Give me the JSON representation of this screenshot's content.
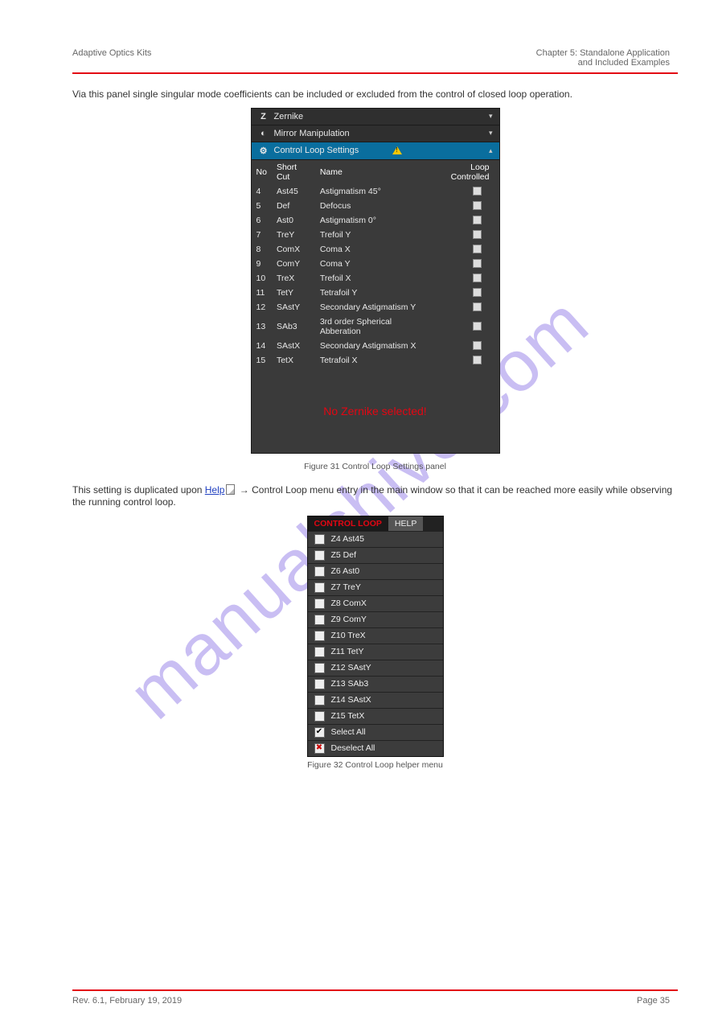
{
  "header": {
    "left": "Adaptive Optics Kits",
    "right_line1": "Chapter 5: Standalone Application",
    "right_line2": "and Included Examples"
  },
  "watermark": "manualshive.com",
  "intro_para": "Via this panel single singular mode coefficients can be included or excluded from the control of closed loop operation.",
  "panel1": {
    "zernike_label": "Zernike",
    "mirror_label": "Mirror Manipulation",
    "cls_label": "Control Loop Settings",
    "columns": {
      "no": "No",
      "shortcut": "Short Cut",
      "name": "Name",
      "loop": "Loop Controlled"
    },
    "rows": [
      {
        "no": "4",
        "sc": "Ast45",
        "name": "Astigmatism 45°"
      },
      {
        "no": "5",
        "sc": "Def",
        "name": "Defocus"
      },
      {
        "no": "6",
        "sc": "Ast0",
        "name": "Astigmatism 0°"
      },
      {
        "no": "7",
        "sc": "TreY",
        "name": "Trefoil Y"
      },
      {
        "no": "8",
        "sc": "ComX",
        "name": "Coma X"
      },
      {
        "no": "9",
        "sc": "ComY",
        "name": "Coma Y"
      },
      {
        "no": "10",
        "sc": "TreX",
        "name": "Trefoil X"
      },
      {
        "no": "11",
        "sc": "TetY",
        "name": "Tetrafoil Y"
      },
      {
        "no": "12",
        "sc": "SAstY",
        "name": "Secondary Astigmatism Y"
      },
      {
        "no": "13",
        "sc": "SAb3",
        "name": "3rd order Spherical Abberation"
      },
      {
        "no": "14",
        "sc": "SAstX",
        "name": "Secondary Astigmatism X"
      },
      {
        "no": "15",
        "sc": "TetX",
        "name": "Tetrafoil X"
      }
    ],
    "warning": "No Zernike selected!"
  },
  "caption1": "Figure 31 Control Loop Settings panel",
  "para2_prefix": "This setting is duplicated upon ",
  "para2_link": "Help",
  "para2_suffix_a": " → ",
  "para2_suffix_b": "Control Loop menu entry in the main window so that it can be reached more easily while observing the running control loop.",
  "panel2": {
    "tab_active": "CONTROL LOOP",
    "tab_other": "HELP",
    "items": [
      "Z4 Ast45",
      "Z5 Def",
      "Z6 Ast0",
      "Z7 TreY",
      "Z8 ComX",
      "Z9 ComY",
      "Z10 TreX",
      "Z11 TetY",
      "Z12 SAstY",
      "Z13 SAb3",
      "Z14 SAstX",
      "Z15 TetX"
    ],
    "select_all": "Select All",
    "deselect_all": "Deselect All"
  },
  "caption2": "Figure 32 Control Loop helper menu",
  "footer": {
    "rev": "Rev. 6.1, February 19, 2019",
    "page": "Page 35"
  }
}
